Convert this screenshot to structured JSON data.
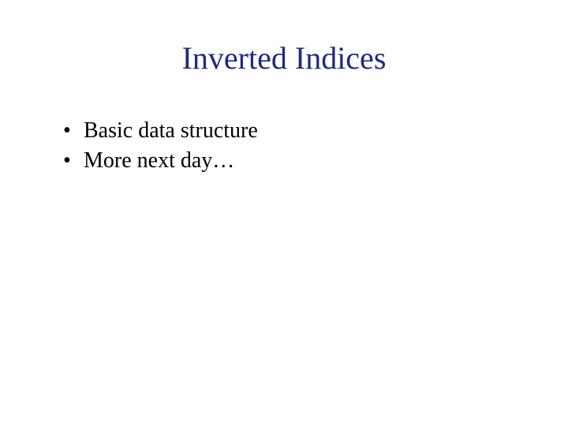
{
  "slide": {
    "title": "Inverted Indices",
    "bullets": {
      "item0": "Basic data structure",
      "item1": "More next day…"
    }
  }
}
